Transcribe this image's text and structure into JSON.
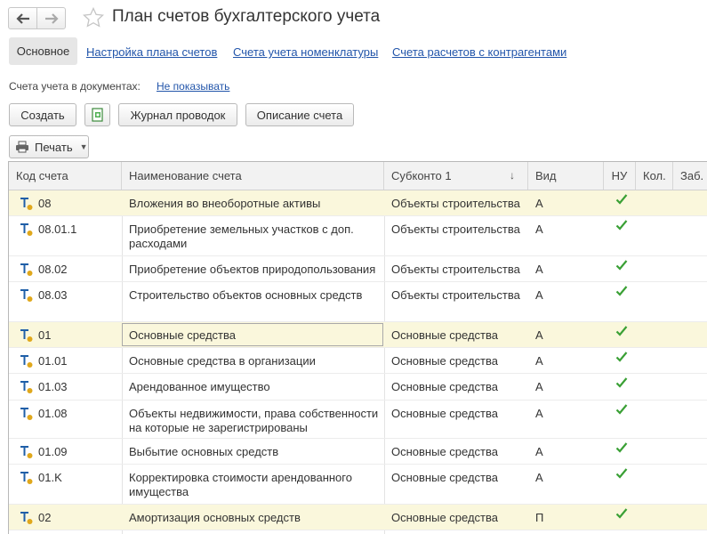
{
  "title": "План счетов бухгалтерского учета",
  "tabs": [
    {
      "label": "Основное",
      "active": true
    },
    {
      "label": "Настройка плана счетов",
      "active": false
    },
    {
      "label": "Счета учета номенклатуры",
      "active": false
    },
    {
      "label": "Счета расчетов с контрагентами",
      "active": false
    }
  ],
  "docs": {
    "label": "Счета учета в документах:",
    "link": "Не показывать"
  },
  "toolbar": {
    "create": "Создать",
    "journal": "Журнал проводок",
    "description": "Описание счета",
    "print": "Печать"
  },
  "table": {
    "columns": {
      "code": "Код счета",
      "name": "Наименование счета",
      "subconto": "Субконто 1",
      "kind": "Вид",
      "nu": "НУ",
      "qty": "Кол.",
      "off": "Заб."
    },
    "rows": [
      {
        "code": "08",
        "name": "Вложения во внеоборотные активы",
        "subconto": "Объекты строительства",
        "kind": "А",
        "nu": true,
        "highlighted": true
      },
      {
        "code": "08.01.1",
        "name": "Приобретение земельных участков с доп. расходами",
        "subconto": "Объекты строительства",
        "kind": "А",
        "nu": true,
        "highlighted": false
      },
      {
        "code": "08.02",
        "name": "Приобретение объектов природопользования",
        "subconto": "Объекты строительства",
        "kind": "А",
        "nu": true,
        "highlighted": false
      },
      {
        "code": "08.03",
        "name": "Строительство объектов основных средств",
        "subconto": "Объекты строительства",
        "kind": "А",
        "nu": true,
        "highlighted": false
      },
      {
        "code": "01",
        "name": "Основные средства",
        "subconto": "Основные средства",
        "kind": "А",
        "nu": true,
        "highlighted": true,
        "selected": true
      },
      {
        "code": "01.01",
        "name": "Основные средства в организации",
        "subconto": "Основные средства",
        "kind": "А",
        "nu": true,
        "highlighted": false
      },
      {
        "code": "01.03",
        "name": "Арендованное имущество",
        "subconto": "Основные средства",
        "kind": "А",
        "nu": true,
        "highlighted": false
      },
      {
        "code": "01.08",
        "name": "Объекты недвижимости, права собственности на которые не зарегистрированы",
        "subconto": "Основные средства",
        "kind": "А",
        "nu": true,
        "highlighted": false
      },
      {
        "code": "01.09",
        "name": "Выбытие основных средств",
        "subconto": "Основные средства",
        "kind": "А",
        "nu": true,
        "highlighted": false
      },
      {
        "code": "01.K",
        "name": "Корректировка стоимости арендованного имущества",
        "subconto": "Основные средства",
        "kind": "А",
        "nu": true,
        "highlighted": false
      },
      {
        "code": "02",
        "name": "Амортизация основных средств",
        "subconto": "Основные средства",
        "kind": "П",
        "nu": true,
        "highlighted": true
      }
    ]
  },
  "colors": {
    "accent_link": "#2255aa",
    "check": "#3aa035",
    "row_highlight": "#faf7dc",
    "account_icon_t": "#1f5fa8",
    "account_icon_dot": "#e0a81c"
  }
}
